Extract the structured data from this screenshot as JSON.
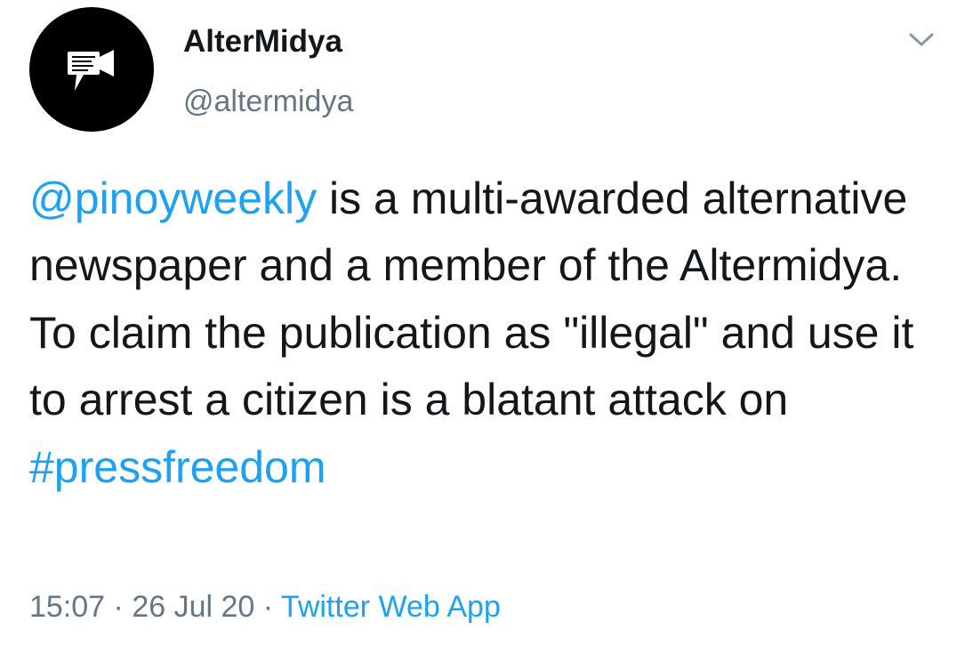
{
  "author": {
    "display_name": "AlterMidya",
    "handle": "@altermidya",
    "avatar_icon": "video-camera-speech-bubble-icon"
  },
  "menu_icon": "chevron-down-icon",
  "tweet": {
    "mention": "@pinoyweekly",
    "body_1": " is a multi-awarded alternative newspaper and a member of the Altermidya. To claim the publication as \"illegal\" and use it to arrest a citizen is a blatant attack on ",
    "hashtag": "#pressfreedom"
  },
  "meta": {
    "time": "15:07",
    "separator": " · ",
    "date": "26 Jul 20",
    "separator_2": " · ",
    "source": "Twitter Web App"
  },
  "colors": {
    "link": "#1da1f2",
    "text": "#14171a",
    "muted": "#657786",
    "avatar_bg": "#000000"
  }
}
